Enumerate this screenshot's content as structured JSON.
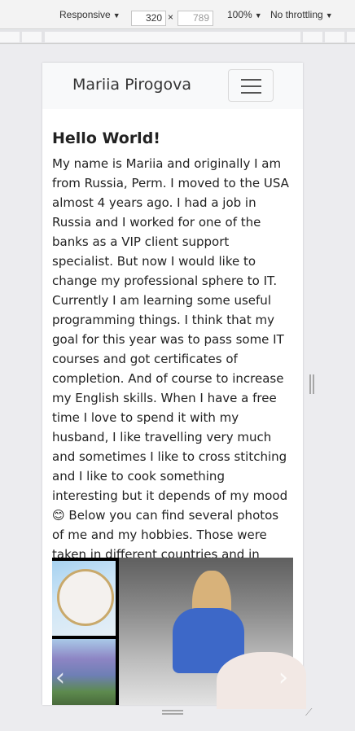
{
  "devtools": {
    "device": "Responsive",
    "width": "320",
    "height": "789",
    "zoom": "100%",
    "throttling": "No throttling",
    "times": "×"
  },
  "navbar": {
    "brand": "Mariia Pirogova",
    "toggler_icon": "hamburger-icon"
  },
  "main": {
    "heading": "Hello World!",
    "paragraph": "My name is Mariia and originally I am from Russia, Perm. I moved to the USA almost 4 years ago. I had a job in Russia and I worked for one of the banks as a VIP client support specialist. But now I would like to change my professional sphere to IT. Currently I am learning some useful programming things. I think that my goal for this year was to pass some IT courses and got certificates of completion. And of course to increase my English skills. When I have a free time I love to spend it with my husband, I like travelling very much and sometimes I like to cross stitching and I like to cook something interesting but it depends of my mood 😊 Below you can find several photos of me and my hobbies. Those were taken in different countries and in different time. Thanks for stopping by!"
  },
  "carousel": {
    "prev": "‹",
    "next": "›"
  }
}
